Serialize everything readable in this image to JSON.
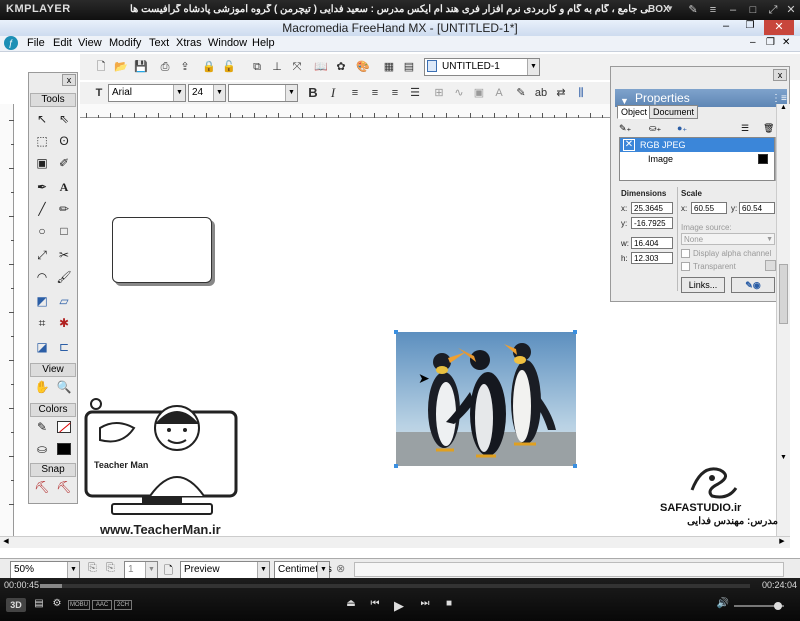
{
  "player": {
    "logo": "KMPLAYER",
    "caption": "مجموعه آموزشی جامع ، گام به گام و کاربردی نرم افزار فری هند ام ایکس   مدرس : سعید فدایی ( تیچرمن ) گروه آموزشی پادشاه گرافیست ها",
    "box_label": "BOX",
    "time_elapsed": "00:00:45",
    "time_total": "00:24:04",
    "progress": 0.031,
    "bottom_badges": [
      "3D",
      "MOBU",
      "AAC",
      "2CH"
    ]
  },
  "window": {
    "title": "Macromedia FreeHand MX - [UNTITLED-1*]"
  },
  "menu": [
    "File",
    "Edit",
    "View",
    "Modify",
    "Text",
    "Xtras",
    "Window",
    "Help"
  ],
  "toolbar": {
    "document_select": "UNTITLED-1",
    "font_family": "Arial",
    "font_size": "24",
    "font_style": ""
  },
  "tools_panel": {
    "close": "x",
    "heading": "Tools",
    "sections": [
      "View",
      "Colors",
      "Snap"
    ]
  },
  "properties": {
    "title": "Properties",
    "tabs": [
      "Object",
      "Document"
    ],
    "list": [
      {
        "label": "RGB JPEG"
      },
      {
        "label": "Image"
      }
    ],
    "dimensions_label": "Dimensions",
    "scale_label": "Scale",
    "x_label": "x:",
    "y_label": "y:",
    "w_label": "w:",
    "h_label": "h:",
    "dim_x": "25.3645",
    "dim_y": "-16.7925",
    "dim_w": "16.404",
    "dim_h": "12.303",
    "scale_x": "60.55",
    "scale_y": "60.54",
    "image_source_label": "Image source:",
    "image_source_value": "None",
    "display_alpha_label": "Display alpha channel",
    "transparent_label": "Transparent",
    "links_button": "Links..."
  },
  "watermark": {
    "teacher_site": "www.TeacherMan.ir",
    "teacher_caption": "Teacher Man",
    "studio": "SAFASTUDIO.ir",
    "instructor": "مدرس: مهندس فدایی"
  },
  "statusbar": {
    "zoom": "50%",
    "page": "1",
    "view_mode": "Preview",
    "units": "Centimeters"
  }
}
